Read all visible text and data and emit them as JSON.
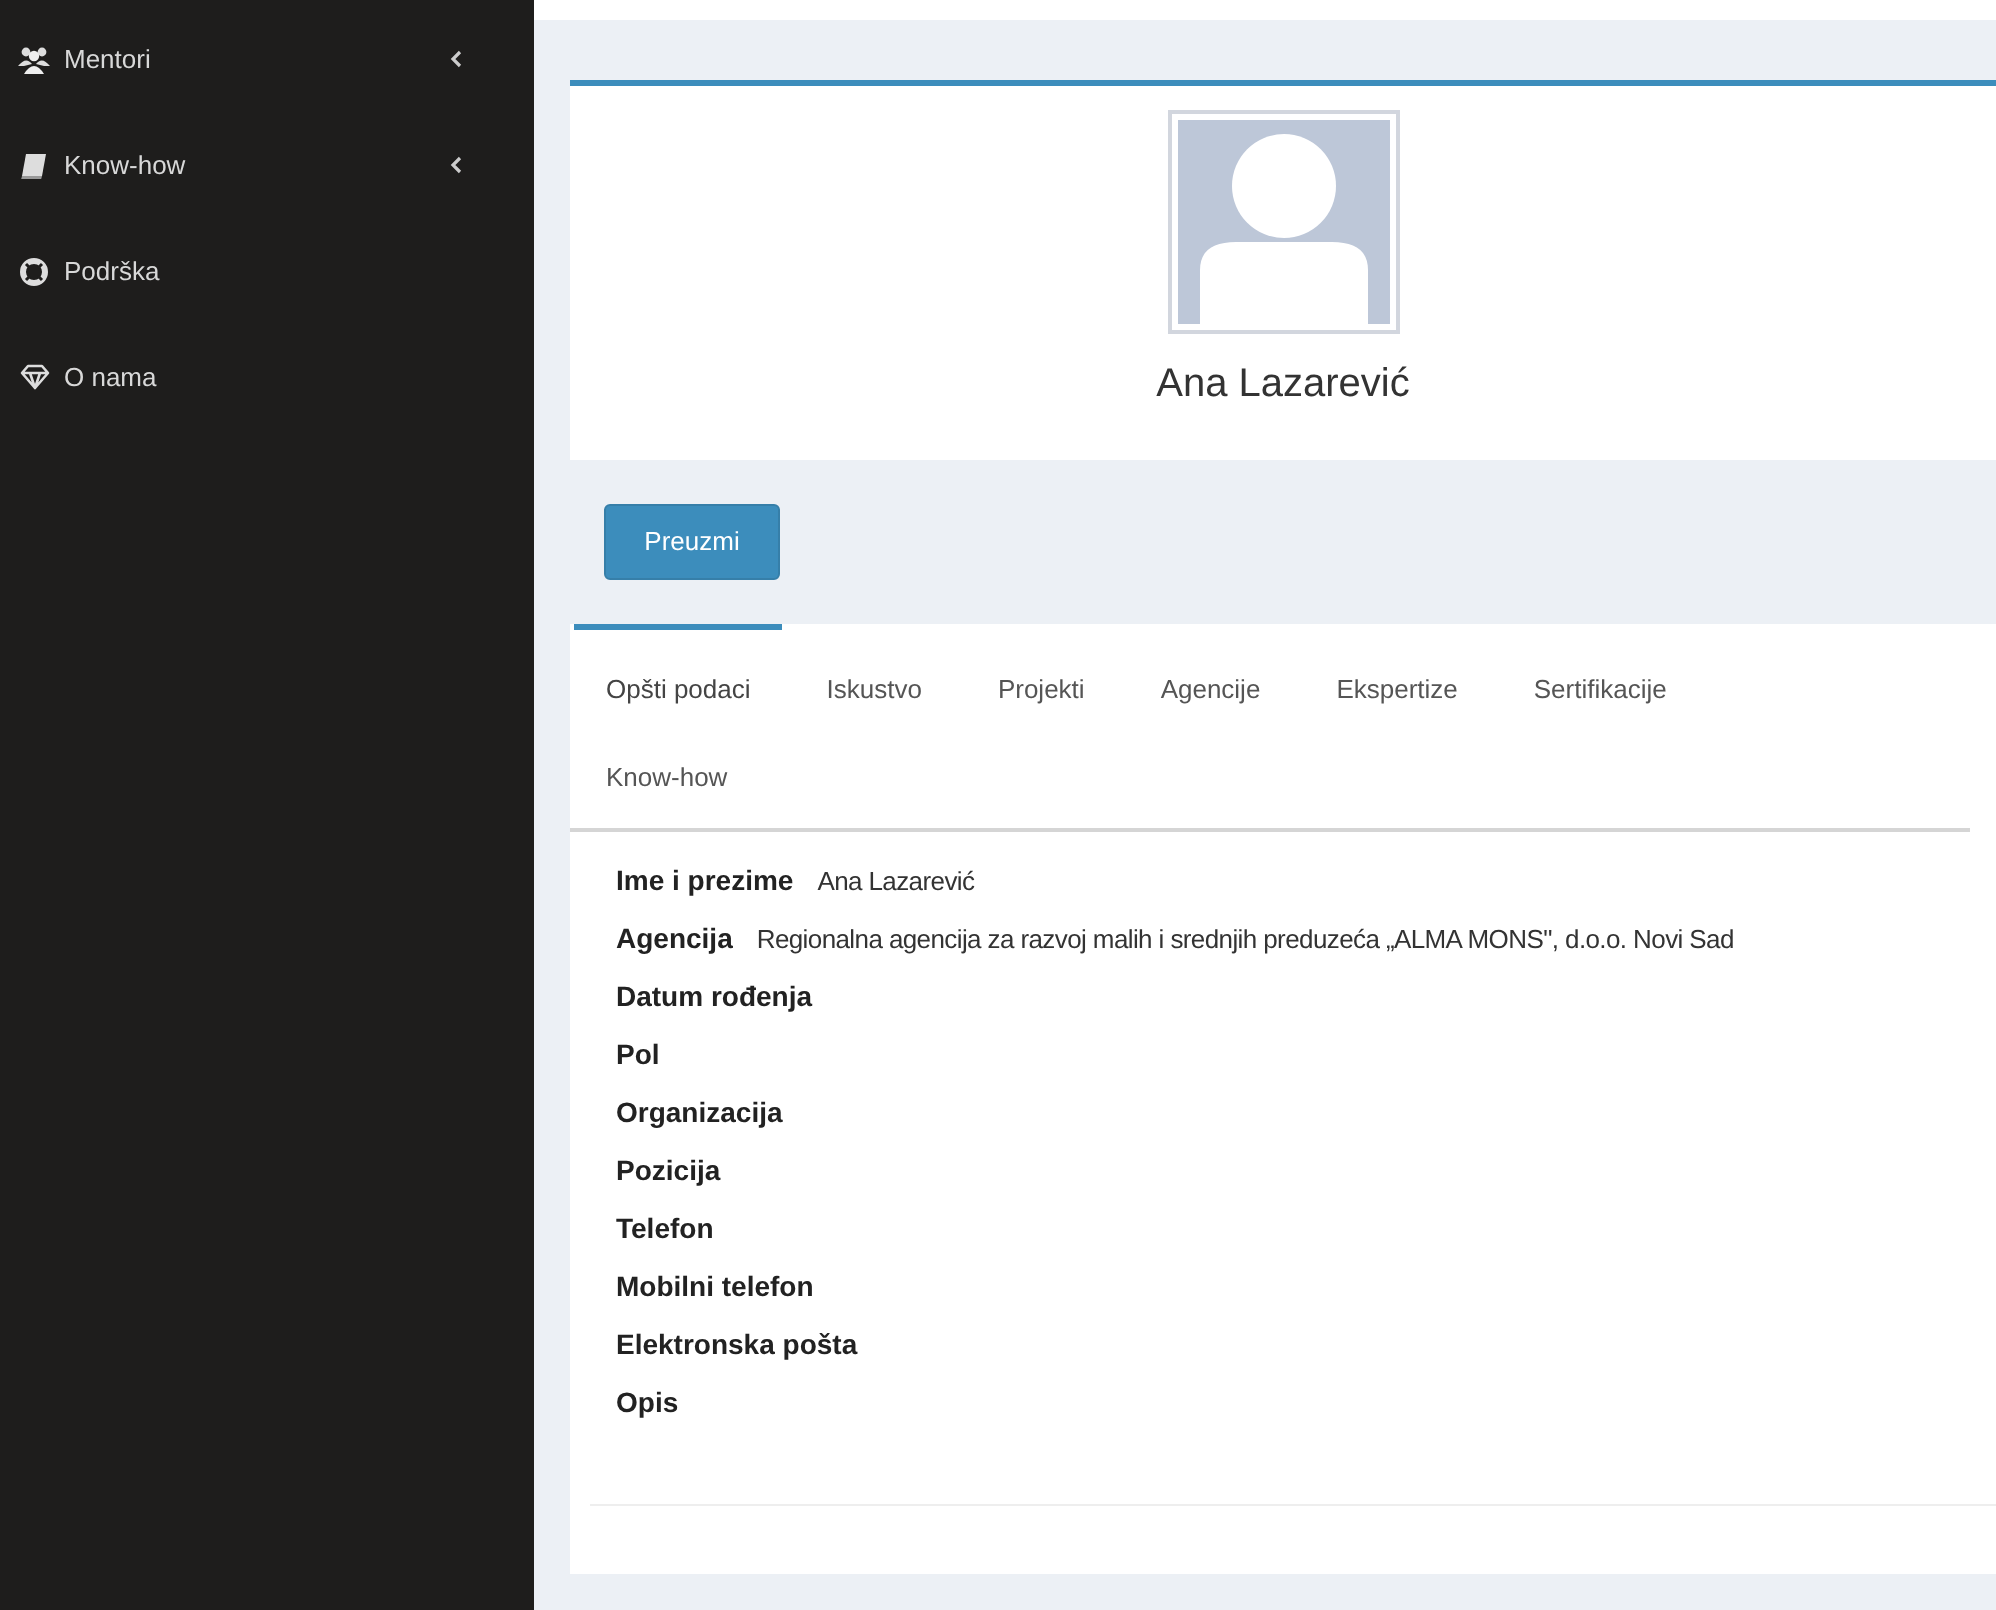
{
  "sidebar": {
    "items": [
      {
        "label": "Mentori",
        "has_submenu": true
      },
      {
        "label": "Know-how",
        "has_submenu": true
      },
      {
        "label": "Podrška",
        "has_submenu": false
      },
      {
        "label": "O nama",
        "has_submenu": false
      }
    ]
  },
  "profile": {
    "name": "Ana Lazarević"
  },
  "download_button": "Preuzmi",
  "tabs": [
    {
      "label": "Opšti podaci",
      "selected": true
    },
    {
      "label": "Iskustvo",
      "selected": false
    },
    {
      "label": "Projekti",
      "selected": false
    },
    {
      "label": "Agencije",
      "selected": false
    },
    {
      "label": "Ekspertize",
      "selected": false
    },
    {
      "label": "Sertifikacije",
      "selected": false
    },
    {
      "label": "Know-how",
      "selected": false
    }
  ],
  "fields": [
    {
      "label": "Ime i prezime",
      "value": "Ana Lazarević"
    },
    {
      "label": "Agencija",
      "value": "Regionalna agencija za razvoj malih i srednjih preduzeća „ALMA MONS\", d.o.o. Novi Sad"
    },
    {
      "label": "Datum rođenja"
    },
    {
      "label": "Pol"
    },
    {
      "label": "Organizacija"
    },
    {
      "label": "Pozicija"
    },
    {
      "label": "Telefon"
    },
    {
      "label": "Mobilni telefon"
    },
    {
      "label": "Elektronska pošta"
    },
    {
      "label": "Opis"
    }
  ]
}
